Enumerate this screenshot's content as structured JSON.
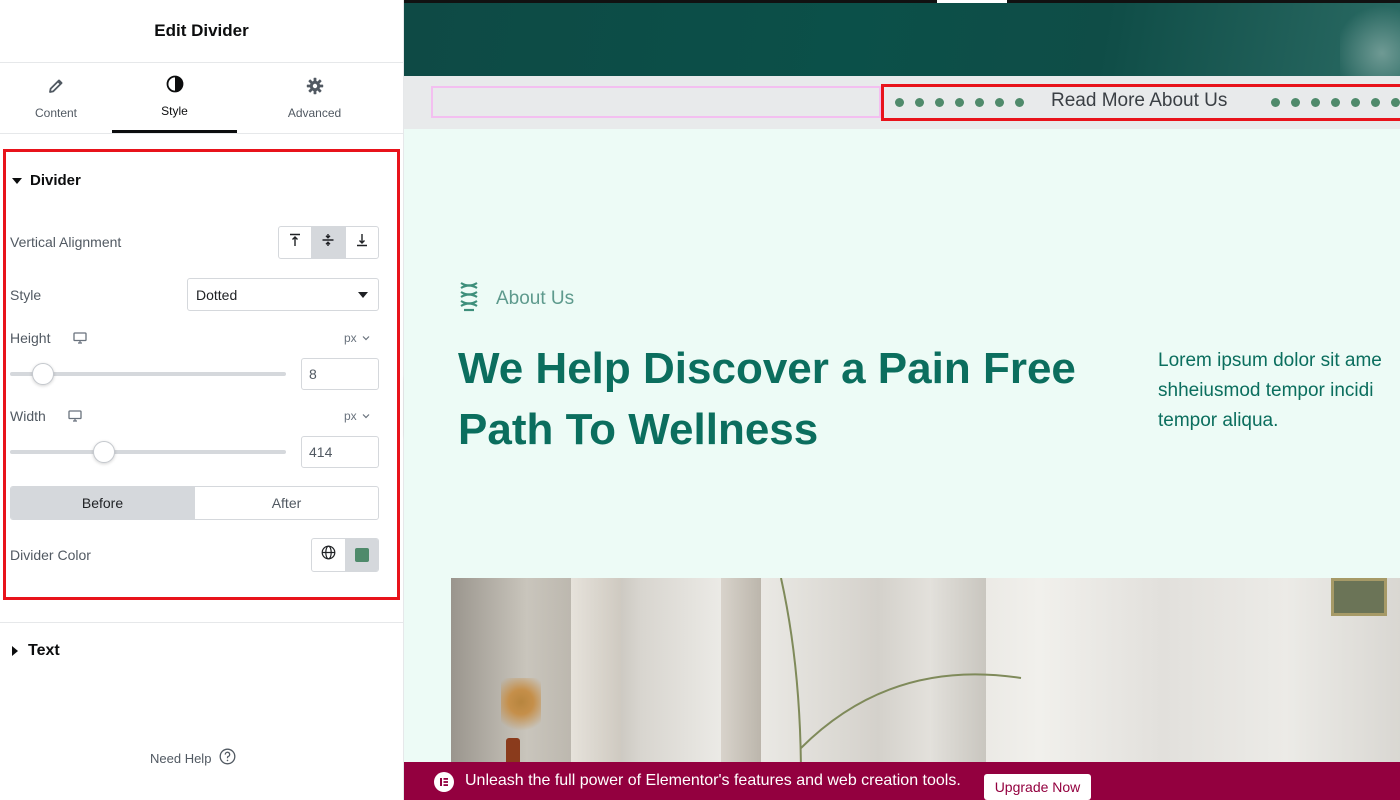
{
  "panel": {
    "title": "Edit Divider",
    "tabs": [
      {
        "label": "Content",
        "icon": "pencil-icon"
      },
      {
        "label": "Style",
        "icon": "contrast-icon"
      },
      {
        "label": "Advanced",
        "icon": "gear-icon"
      }
    ],
    "active_tab": "Style",
    "divider_section": {
      "heading": "Divider",
      "vertical_alignment": {
        "label": "Vertical Alignment",
        "options": [
          "top-icon",
          "middle-icon",
          "bottom-icon"
        ],
        "selected": "middle"
      },
      "style": {
        "label": "Style",
        "value": "Dotted"
      },
      "height": {
        "label": "Height",
        "unit": "px",
        "value": "8",
        "slider_fraction": 0.12
      },
      "width": {
        "label": "Width",
        "unit": "px",
        "value": "414",
        "slider_fraction": 0.34
      },
      "position_switch": {
        "options": [
          "Before",
          "After"
        ],
        "selected": "Before"
      },
      "color": {
        "label": "Divider Color",
        "value": "#4f8a6b"
      }
    },
    "text_section": {
      "heading": "Text"
    },
    "help": {
      "label": "Need Help"
    }
  },
  "preview": {
    "read_more": "Read More About Us",
    "eyebrow": "About Us",
    "headline": "We Help Discover a Pain Free Path To Wellness",
    "lorem_lines": [
      "Lorem ipsum dolor sit ame",
      "shheiusmod tempor incidi",
      "tempor aliqua."
    ],
    "accent_color": "#0b6e5e"
  },
  "promo": {
    "text": "Unleash the full power of Elementor's features and web creation tools.",
    "button": "Upgrade Now",
    "bg_color": "#93003f"
  }
}
